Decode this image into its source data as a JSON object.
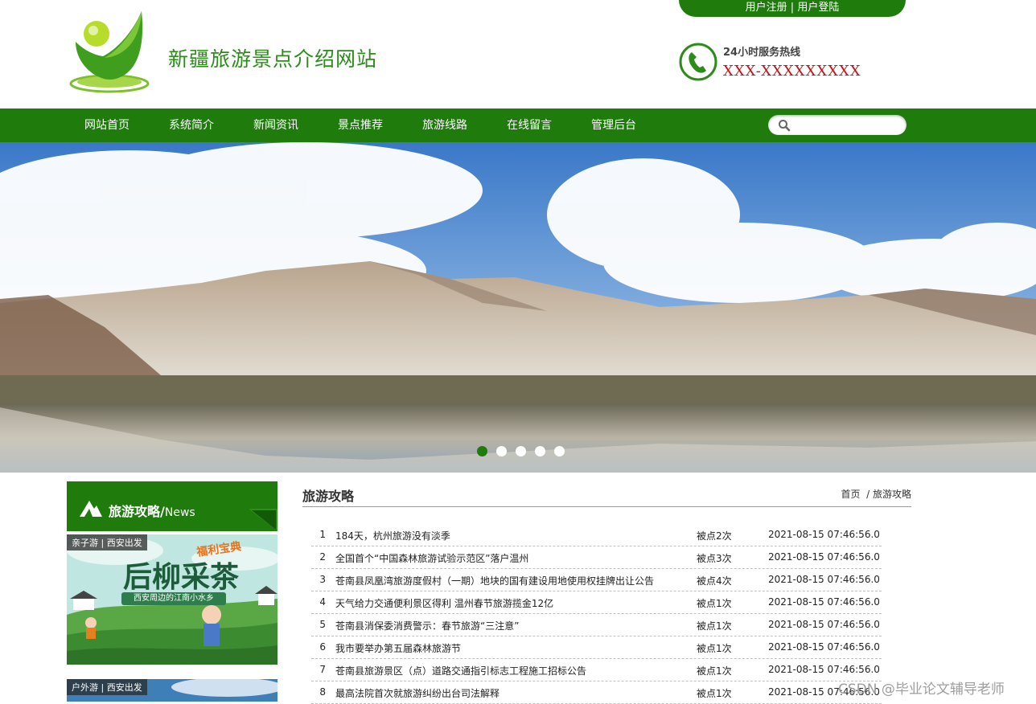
{
  "header": {
    "user_links": {
      "register": "用户注册",
      "separator": "|",
      "login": "用户登陆"
    },
    "site_title": "新疆旅游景点介绍网站",
    "hotline_label": "24小时服务热线",
    "hotline_number": "XXX-XXXXXXXXX"
  },
  "nav": {
    "items": [
      {
        "label": "网站首页"
      },
      {
        "label": "系统简介"
      },
      {
        "label": "新闻资讯"
      },
      {
        "label": "景点推荐"
      },
      {
        "label": "旅游线路"
      },
      {
        "label": "在线留言"
      },
      {
        "label": "管理后台"
      }
    ],
    "search_placeholder": ""
  },
  "banner": {
    "slide_count": 5,
    "active_slide": 1
  },
  "sidebar": {
    "title": "旅游攻略/",
    "title_en": "News",
    "promos": [
      {
        "tag": "亲子游 | 西安出发",
        "headline": "后柳采茶",
        "tagline": "福利宝典",
        "subline": "西安周边的江南小水乡"
      },
      {
        "tag": "户外游 | 西安出发"
      }
    ]
  },
  "main": {
    "title": "旅游攻略",
    "breadcrumb": {
      "home": "首页",
      "separator": "/",
      "current": "旅游攻略"
    },
    "articles": [
      {
        "num": "1",
        "title": "184天，杭州旅游没有淡季",
        "views": "被点2次",
        "time": "2021-08-15 07:46:56.0"
      },
      {
        "num": "2",
        "title": "全国首个“中国森林旅游试验示范区”落户温州",
        "views": "被点3次",
        "time": "2021-08-15 07:46:56.0"
      },
      {
        "num": "3",
        "title": "苍南县凤凰湾旅游度假村（一期）地块的国有建设用地使用权挂牌出让公告",
        "views": "被点4次",
        "time": "2021-08-15 07:46:56.0"
      },
      {
        "num": "4",
        "title": "天气给力交通便利景区得利 温州春节旅游揽金12亿",
        "views": "被点1次",
        "time": "2021-08-15 07:46:56.0"
      },
      {
        "num": "5",
        "title": "苍南县消保委消费警示：春节旅游“三注意”",
        "views": "被点1次",
        "time": "2021-08-15 07:46:56.0"
      },
      {
        "num": "6",
        "title": "我市要举办第五届森林旅游节",
        "views": "被点1次",
        "time": "2021-08-15 07:46:56.0"
      },
      {
        "num": "7",
        "title": "苍南县旅游景区（点）道路交通指引标志工程施工招标公告",
        "views": "被点1次",
        "time": "2021-08-15 07:46:56.0"
      },
      {
        "num": "8",
        "title": "最高法院首次就旅游纠纷出台司法解释",
        "views": "被点1次",
        "time": "2021-08-15 07:46:56.0"
      }
    ]
  },
  "watermark": "CSDN @毕业论文辅导老师",
  "colors": {
    "brand_green": "#1e7b0c",
    "hotline_red": "#c0141c",
    "title_green": "#2b8c1a"
  }
}
